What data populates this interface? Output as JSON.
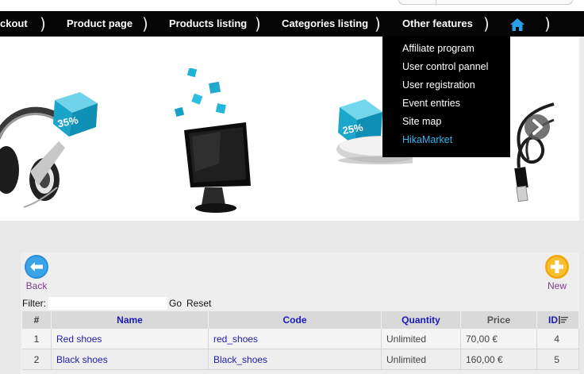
{
  "nav": {
    "items": [
      {
        "label": "ckout"
      },
      {
        "label": "Product page"
      },
      {
        "label": "Products listing"
      },
      {
        "label": "Categories listing"
      },
      {
        "label": "Other features"
      }
    ],
    "separator": ")",
    "home_icon": "home-icon"
  },
  "dropdown": {
    "items": [
      {
        "label": "Affiliate program"
      },
      {
        "label": "User control pannel"
      },
      {
        "label": "User registration"
      },
      {
        "label": "Event entries"
      },
      {
        "label": "Site map"
      },
      {
        "label": "HikaMarket",
        "active": true
      }
    ]
  },
  "banner": {
    "badges": [
      "35%",
      "25%"
    ],
    "next_icon": "chevron-right-icon"
  },
  "toolbar": {
    "back_label": "Back",
    "new_label": "New"
  },
  "filter": {
    "label": "Filter:",
    "value": "",
    "go_label": "Go",
    "reset_label": "Reset"
  },
  "table": {
    "headers": {
      "num": "#",
      "name": "Name",
      "code": "Code",
      "quantity": "Quantity",
      "price": "Price",
      "id": "ID"
    },
    "rows": [
      {
        "num": "1",
        "name": "Red shoes",
        "code": "red_shoes",
        "quantity": "Unlimited",
        "price": "70,00 €",
        "id": "4"
      },
      {
        "num": "2",
        "name": "Black shoes",
        "code": "Black_shoes",
        "quantity": "Unlimited",
        "price": "160,00 €",
        "id": "5"
      }
    ]
  },
  "colors": {
    "nav_bg": "#050505",
    "dropdown_active": "#35b5f0",
    "link": "#1d1dab",
    "back_button": "#2a8fd6",
    "new_button": "#f2a50a"
  }
}
